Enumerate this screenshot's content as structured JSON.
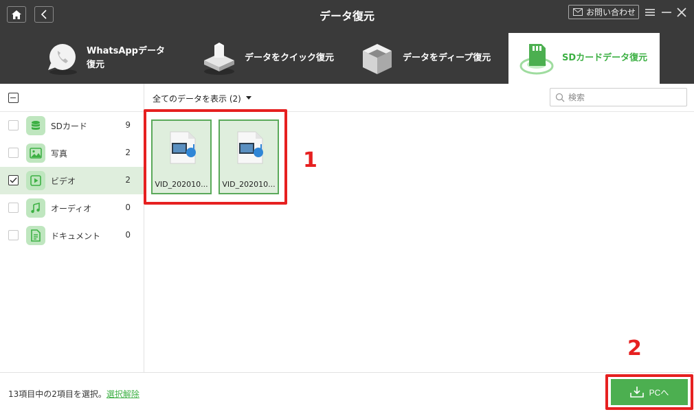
{
  "header": {
    "title": "データ復元",
    "contact_label": "お問い合わせ"
  },
  "tabs": [
    {
      "label": "WhatsAppデータ復元",
      "active": false
    },
    {
      "label": "データをクイック復元",
      "active": false
    },
    {
      "label": "データをディープ復元",
      "active": false
    },
    {
      "label": "SDカードデータ復元",
      "active": true
    }
  ],
  "sidebar": {
    "items": [
      {
        "label": "SDカード",
        "count": "9",
        "checked": false,
        "icon": "database-icon"
      },
      {
        "label": "写真",
        "count": "2",
        "checked": false,
        "icon": "image-icon"
      },
      {
        "label": "ビデオ",
        "count": "2",
        "checked": true,
        "icon": "video-play-icon"
      },
      {
        "label": "オーディオ",
        "count": "0",
        "checked": false,
        "icon": "music-note-icon"
      },
      {
        "label": "ドキュメント",
        "count": "0",
        "checked": false,
        "icon": "document-icon"
      }
    ]
  },
  "toolbar": {
    "filter_label": "全てのデータを表示 (2)",
    "search_placeholder": "検索"
  },
  "files": [
    {
      "name": "VID_202010..."
    },
    {
      "name": "VID_202010..."
    }
  ],
  "annotations": {
    "marker_1": "1",
    "marker_2": "2",
    "color": "#e62020"
  },
  "footer": {
    "status_text": "13項目中の2項目を選択。",
    "deselect_label": "選択解除",
    "export_button_label": "PCへ"
  },
  "colors": {
    "accent": "#4caf50",
    "header_bg": "#3a3a3a",
    "selected_bg": "#dfeedd"
  }
}
